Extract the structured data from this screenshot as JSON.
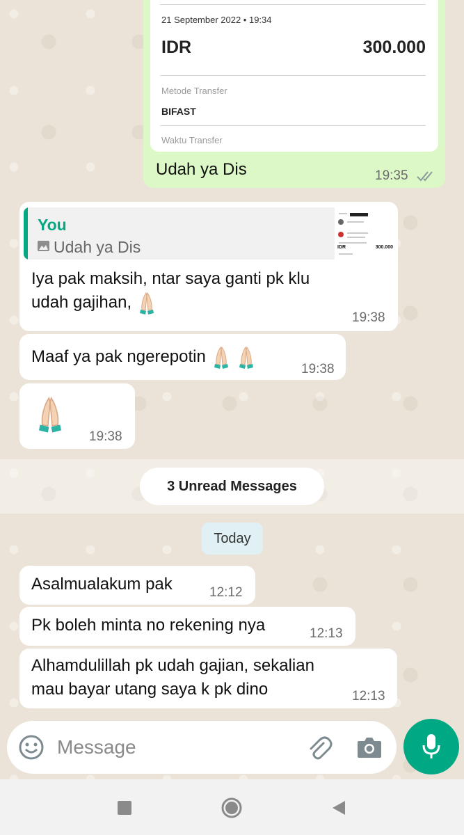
{
  "receipt": {
    "date": "21 September 2022 • 19:34",
    "currency": "IDR",
    "amount": "300.000",
    "method_label": "Metode Transfer",
    "method_value": "BIFAST",
    "time_label": "Waktu Transfer"
  },
  "outgoing": {
    "caption": "Udah ya Dis",
    "time": "19:35",
    "status_icon": "double-check-icon"
  },
  "messages_before": [
    {
      "quote_author": "You",
      "quote_text": "Udah ya Dis",
      "quote_thumbnail_currency": "IDR",
      "quote_thumbnail_amount": "300.000",
      "text_line1": "Iya pak maksih, ntar saya ganti pk klu",
      "text_line2": "udah gajihan,",
      "time": "19:38"
    },
    {
      "text": "Maaf ya pak ngerepotin",
      "time": "19:38"
    },
    {
      "text": "",
      "time": "19:38"
    }
  ],
  "unread_label": "3 Unread Messages",
  "day_label": "Today",
  "messages_after": [
    {
      "text": "Asalmualakum pak",
      "time": "12:12"
    },
    {
      "text": "Pk boleh minta no rekening nya",
      "time": "12:13"
    },
    {
      "text_line1": "Alhamdulillah pk udah gajian, sekalian",
      "text_line2": "mau bayar utang saya k pk dino",
      "time": "12:13"
    }
  ],
  "composer": {
    "placeholder": "Message",
    "icons": [
      "emoji-icon",
      "attach-icon",
      "camera-icon",
      "mic-icon"
    ]
  },
  "navigation": [
    "recents-icon",
    "home-icon",
    "back-icon"
  ],
  "colors": {
    "accent": "#00a884",
    "outgoing_bubble": "#dcf8c6",
    "quote_author": "#06a884"
  }
}
